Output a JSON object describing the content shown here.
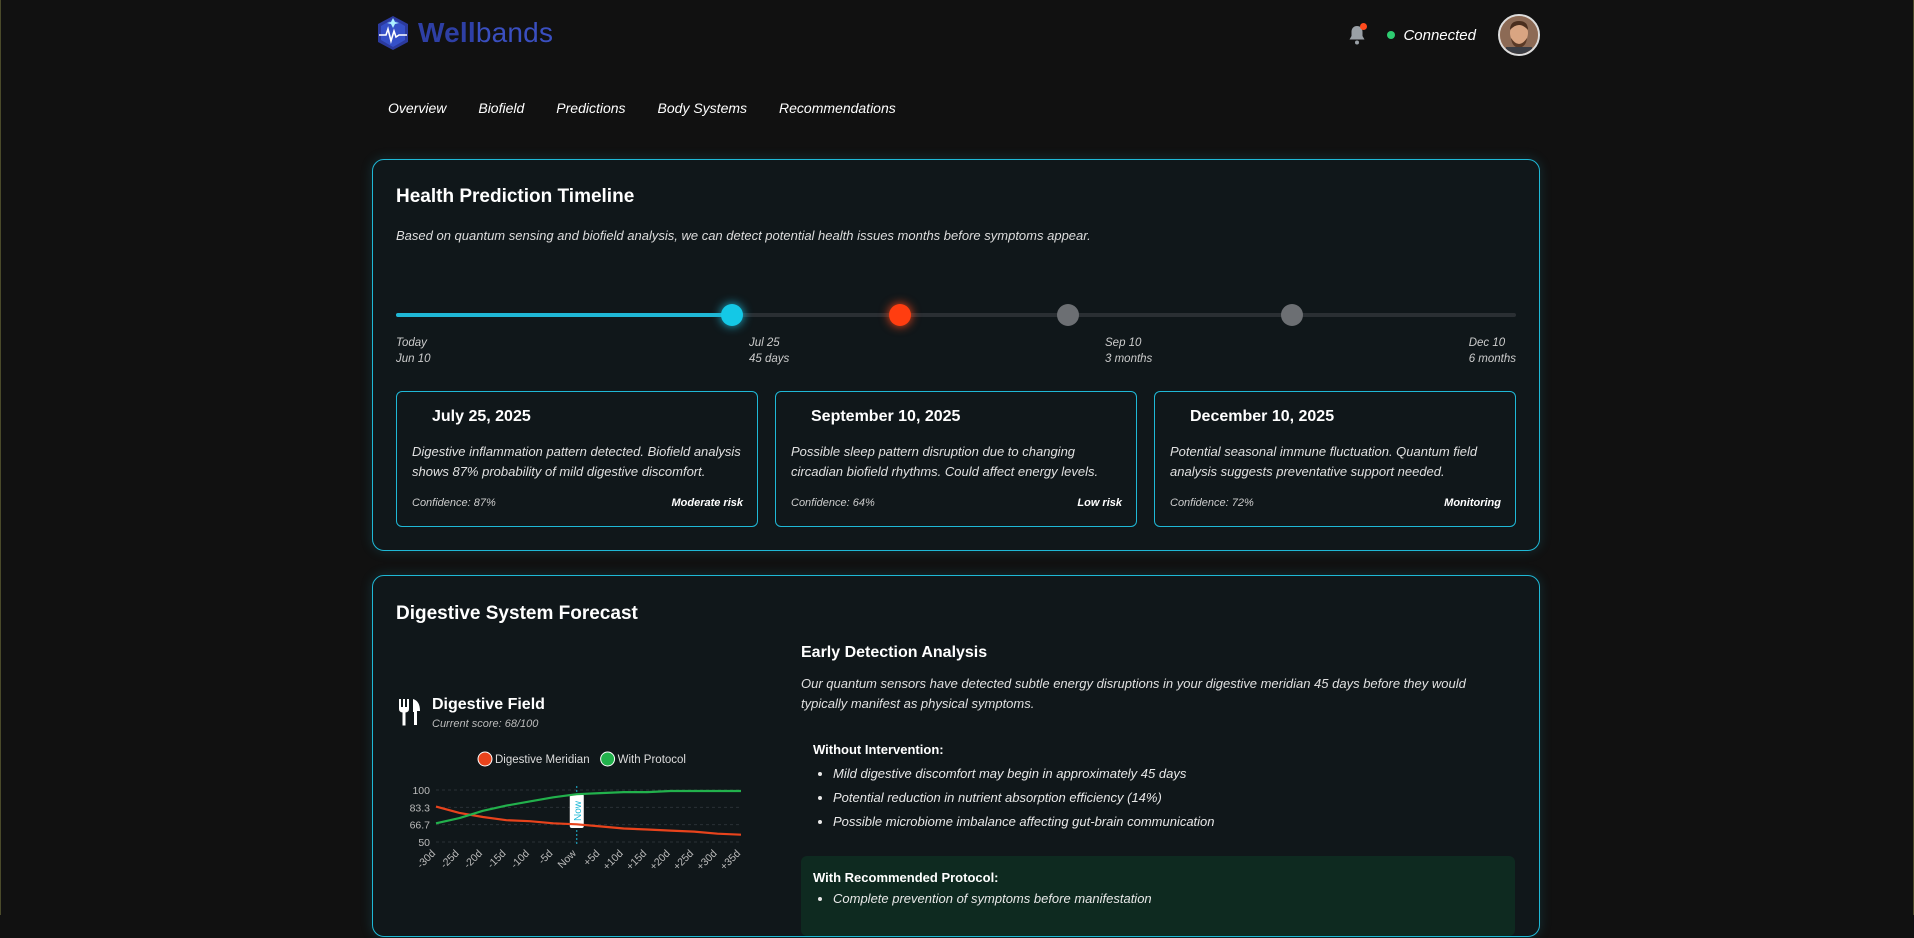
{
  "brand": {
    "name_bold": "Well",
    "name_light": "bands"
  },
  "header": {
    "status": "Connected"
  },
  "tabs": [
    "Overview",
    "Biofield",
    "Predictions",
    "Body Systems",
    "Recommendations"
  ],
  "timeline_card": {
    "title": "Health Prediction Timeline",
    "subtitle": "Based on quantum sensing and biofield analysis, we can detect potential health issues months before symptoms appear.",
    "progress_fraction": 0.3,
    "labels": [
      {
        "line1": "Today",
        "line2": "Jun 10"
      },
      {
        "line1": "Jul 25",
        "line2": "45 days"
      },
      {
        "line1": "Sep 10",
        "line2": "3 months"
      },
      {
        "line1": "Dec 10",
        "line2": "6 months"
      }
    ],
    "events": [
      {
        "date": "July 25, 2025",
        "text": "Digestive inflammation pattern detected. Biofield analysis shows 87% probability of mild digestive discomfort.",
        "confidence": "Confidence: 87%",
        "risk": "Moderate risk"
      },
      {
        "date": "September 10, 2025",
        "text": "Possible sleep pattern disruption due to changing circadian biofield rhythms. Could affect energy levels.",
        "confidence": "Confidence: 64%",
        "risk": "Low risk"
      },
      {
        "date": "December 10, 2025",
        "text": "Potential seasonal immune fluctuation. Quantum field analysis suggests preventative support needed.",
        "confidence": "Confidence: 72%",
        "risk": "Monitoring"
      }
    ]
  },
  "forecast_card": {
    "title": "Digestive System Forecast",
    "field_title": "Digestive Field",
    "field_score": "Current score: 68/100",
    "eda_title": "Early Detection Analysis",
    "eda_text": "Our quantum sensors have detected subtle energy disruptions in your digestive meridian 45 days before they would typically manifest as physical symptoms.",
    "without_title": "Without Intervention:",
    "without_items": [
      "Mild digestive discomfort may begin in approximately 45 days",
      "Potential reduction in nutrient absorption efficiency (14%)",
      "Possible microbiome imbalance affecting gut-brain communication"
    ],
    "protocol_title": "With Recommended Protocol:",
    "protocol_items": [
      "Complete prevention of symptoms before manifestation"
    ]
  },
  "chart_data": {
    "type": "line",
    "categories": [
      "-30d",
      "-25d",
      "-20d",
      "-15d",
      "-10d",
      "-5d",
      "Now",
      "+5d",
      "+10d",
      "+15d",
      "+20d",
      "+25d",
      "+30d",
      "+35d"
    ],
    "series": [
      {
        "name": "Digestive Meridian",
        "color": "#e8431c",
        "values": [
          84,
          78,
          74,
          71,
          70,
          68,
          67,
          65,
          63,
          62,
          61,
          60,
          58,
          57
        ]
      },
      {
        "name": "With Protocol",
        "color": "#22b14c",
        "values": [
          68,
          73,
          80,
          85,
          89,
          93,
          96,
          97,
          98,
          98,
          99,
          99,
          99,
          99
        ]
      }
    ],
    "y_ticks": [
      "100",
      "83.3",
      "66.7",
      "50"
    ],
    "ylim": [
      50,
      100
    ],
    "annotation": "Now",
    "legend_position": "top"
  }
}
